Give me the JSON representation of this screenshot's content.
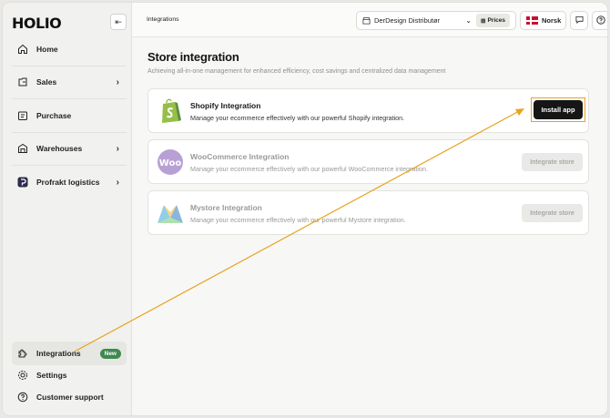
{
  "app": {
    "logo": "HOLIO",
    "collapse_icon": "collapse-icon"
  },
  "sidebar": {
    "items": [
      {
        "label": "Home",
        "icon": "home-icon"
      },
      {
        "label": "Sales",
        "icon": "sales-icon",
        "chevron": "›"
      },
      {
        "label": "Purchase",
        "icon": "purchase-icon"
      },
      {
        "label": "Warehouses",
        "icon": "warehouse-icon",
        "chevron": "›"
      },
      {
        "label": "Profrakt logistics",
        "icon": "profrakt-icon",
        "chevron": "›"
      }
    ],
    "bottom_items": [
      {
        "label": "Integrations",
        "icon": "integrations-icon",
        "badge": "New"
      },
      {
        "label": "Settings",
        "icon": "gear-icon"
      },
      {
        "label": "Customer support",
        "icon": "help-icon"
      }
    ]
  },
  "topbar": {
    "breadcrumb": "Integrations",
    "company": "DerDesign Distributør",
    "prices_label": "Prices",
    "language": "Norsk"
  },
  "main": {
    "title": "Store integration",
    "subtitle": "Achieving all-in-one management for enhanced efficiency, cost savings and centralized data management",
    "integrations": [
      {
        "name": "Shopify Integration",
        "description": "Manage your ecommerce effectively with our powerful Shopify integration.",
        "button": "Install app",
        "enabled": true
      },
      {
        "name": "WooCommerce Integration",
        "description": "Manage your ecommerce effectively with our powerful WooCommerce integration.",
        "button": "Integrate store",
        "enabled": false
      },
      {
        "name": "Mystore Integration",
        "description": "Manage your ecommerce effectively with our powerful Mystore integration.",
        "button": "Integrate store",
        "enabled": false
      }
    ]
  },
  "colors": {
    "accent_highlight": "#e8a321",
    "new_badge": "#3e8a4f",
    "shopify_green": "#95bf47",
    "woo_purple": "#7f54b3"
  },
  "woo_logo_text": "Woo"
}
